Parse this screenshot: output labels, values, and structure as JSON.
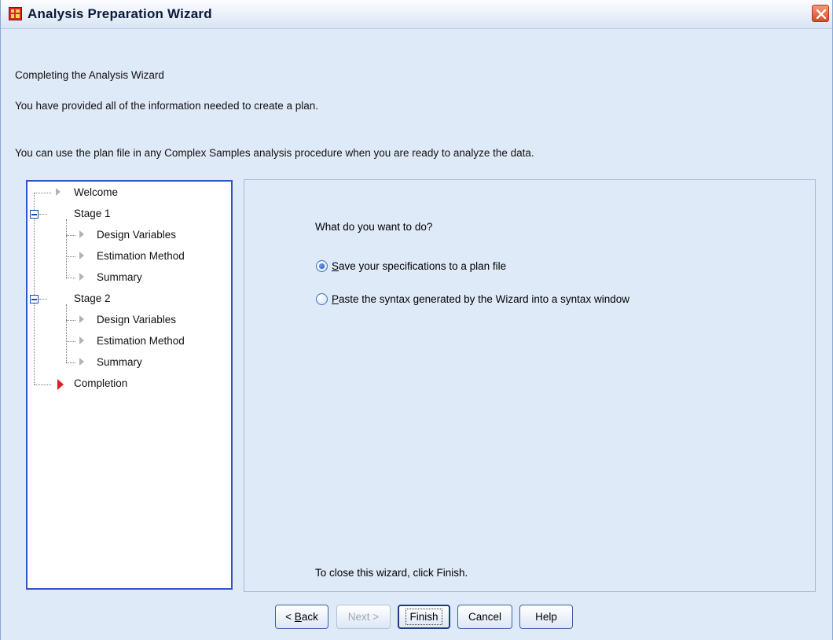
{
  "window": {
    "title": "Analysis Preparation Wizard"
  },
  "header": {
    "heading": "Completing the Analysis Wizard",
    "line1": "You have provided all of the information needed to create a plan.",
    "line2": "You can use the plan file in any Complex Samples analysis procedure when you are ready to analyze the data."
  },
  "tree": {
    "welcome": "Welcome",
    "stage1": "Stage 1",
    "stage1_items": [
      "Design Variables",
      "Estimation Method",
      "Summary"
    ],
    "stage2": "Stage 2",
    "stage2_items": [
      "Design Variables",
      "Estimation Method",
      "Summary"
    ],
    "completion": "Completion",
    "active_marker_color": "#e11e1e"
  },
  "content": {
    "question": "What do you want to do?",
    "option_save": {
      "prefix": "",
      "mnemonic": "S",
      "rest": "ave your specifications to a plan file",
      "checked": true
    },
    "option_paste": {
      "prefix": "",
      "mnemonic": "P",
      "rest": "aste the syntax generated by the Wizard into a syntax window",
      "checked": false
    },
    "close_hint": "To close this wizard, click Finish."
  },
  "buttons": {
    "back_prefix": "< ",
    "back_mnemonic": "B",
    "back_rest": "ack",
    "next": "Next >",
    "finish": "Finish",
    "cancel": "Cancel",
    "help": "Help"
  },
  "colors": {
    "background": "#dfeaf9",
    "tree_border": "#2c58c4"
  }
}
